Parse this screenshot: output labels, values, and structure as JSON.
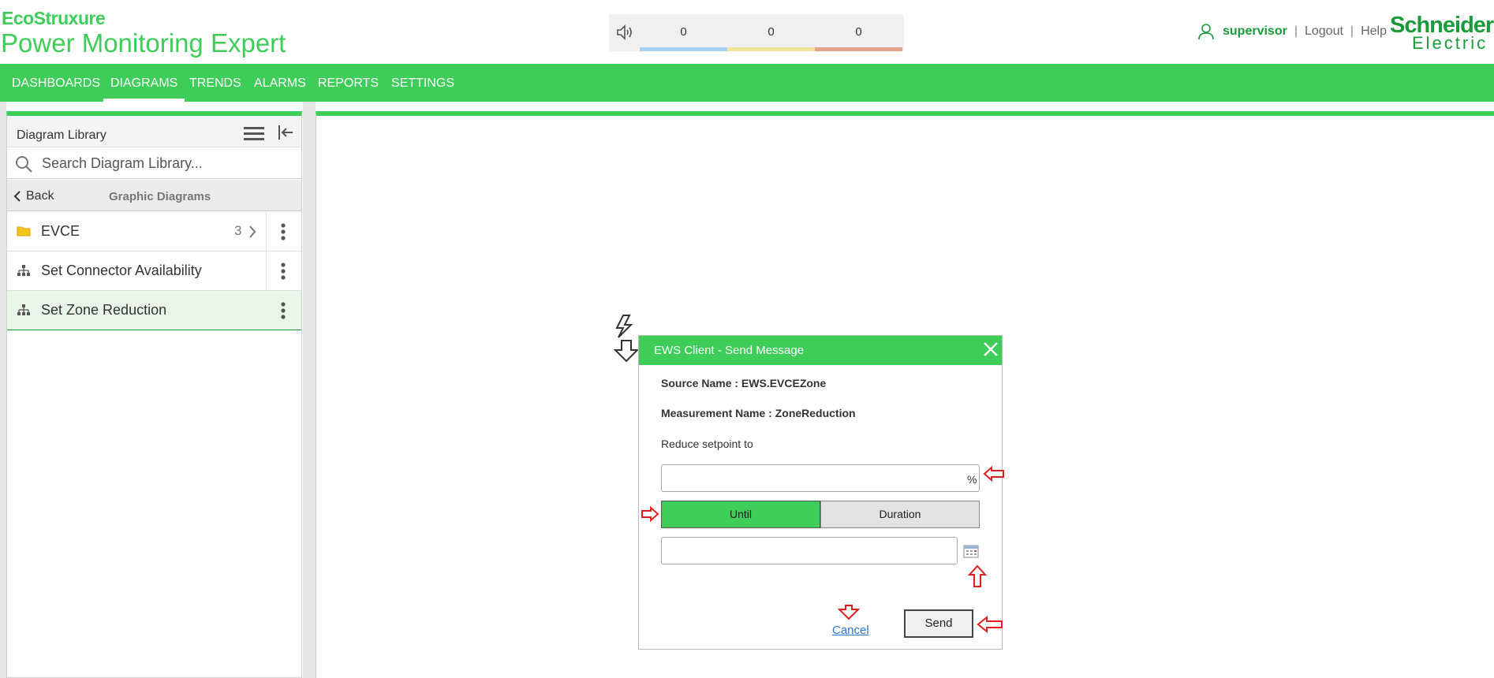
{
  "header": {
    "brand_top": "EcoStruxure",
    "brand_product": "Power Monitoring Expert",
    "alarms": [
      {
        "count": "0",
        "color": "#a7cff0"
      },
      {
        "count": "0",
        "color": "#f2e29a"
      },
      {
        "count": "0",
        "color": "#eaa08f"
      }
    ],
    "user": "supervisor",
    "logout": "Logout",
    "help": "Help",
    "separator": "|",
    "vendor_line1": "Schneider",
    "vendor_line2": "Electric"
  },
  "nav": {
    "items": [
      "DASHBOARDS",
      "DIAGRAMS",
      "TRENDS",
      "ALARMS",
      "REPORTS",
      "SETTINGS"
    ],
    "active": "DIAGRAMS"
  },
  "library": {
    "title": "Diagram Library",
    "search_placeholder": "Search Diagram Library...",
    "back_label": "Back",
    "section_title": "Graphic Diagrams",
    "items": [
      {
        "label": "EVCE",
        "type": "folder",
        "count": "3"
      },
      {
        "label": "Set Connector Availability",
        "type": "diagram"
      },
      {
        "label": "Set Zone Reduction",
        "type": "diagram",
        "selected": true
      }
    ]
  },
  "dialog": {
    "title": "EWS Client - Send Message",
    "source_name": "Source Name : EWS.EVCEZone",
    "measurement_name": "Measurement Name : ZoneReduction",
    "prompt": "Reduce setpoint to",
    "percent_value": "",
    "percent_unit": "%",
    "until_label": "Until",
    "duration_label": "Duration",
    "date_value": "",
    "cancel_label": "Cancel",
    "send_label": "Send"
  },
  "colors": {
    "brand_green": "#3dcd58",
    "dark_green": "#1b9a3a",
    "annotation_red": "#e02020"
  }
}
